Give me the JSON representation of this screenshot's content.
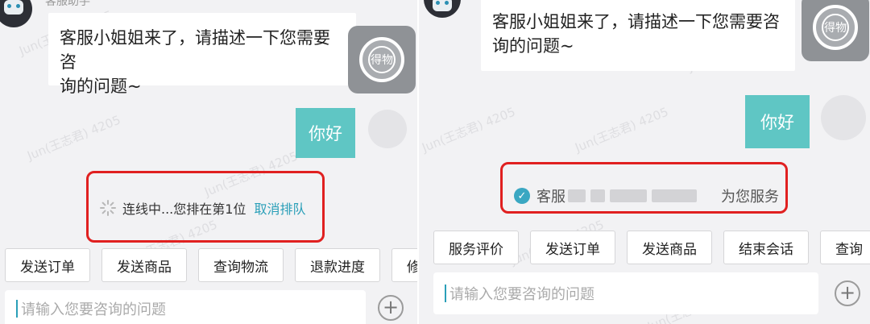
{
  "left": {
    "agent_name": "客服助手",
    "greeting_line1": "客服小姐姐来了，请描述一下您需要咨",
    "greeting_line2": "询的问题~",
    "brand_logo_text": "得物",
    "user_message": "你好",
    "queue_status": "连线中...您排在第1位",
    "cancel_queue": "取消排队",
    "quick_actions": [
      "发送订单",
      "发送商品",
      "查询物流",
      "退款进度",
      "修改:"
    ],
    "input_placeholder": "请输入您要咨询的问题",
    "plus_label": "+"
  },
  "right": {
    "greeting_line1": "客服小姐姐来了，请描述一下您需要咨",
    "greeting_line2": "询的问题~",
    "brand_logo_text": "得物",
    "user_message": "你好",
    "service_prefix": "客服",
    "service_suffix": "为您服务",
    "quick_actions": [
      "服务评价",
      "发送订单",
      "发送商品",
      "结束会话",
      "查询"
    ],
    "input_placeholder": "请输入您要咨询的问题",
    "plus_label": "+"
  },
  "watermark_text": "Jun(王志君) 4205",
  "colors": {
    "accent": "#5fc6c4",
    "link": "#2a9fb8",
    "highlight": "#e02020",
    "background": "#f2f2f4"
  }
}
